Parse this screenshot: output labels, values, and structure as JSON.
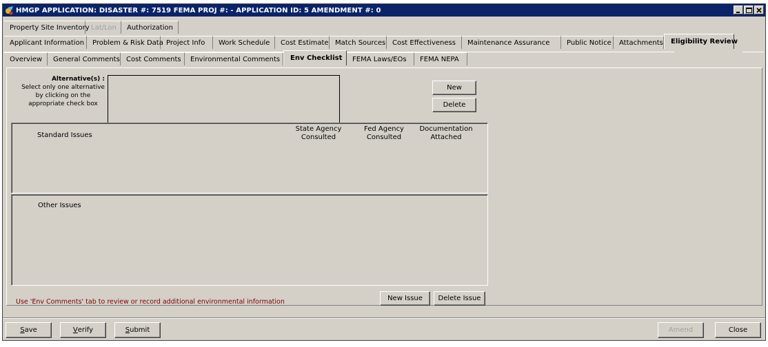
{
  "window": {
    "title": "HMGP APPLICATION:  DISASTER #: 7519   FEMA PROJ #:  -    APPLICATION ID: 5   AMENDMENT #: 0",
    "controls": [
      "minimize-icon",
      "maximize-icon",
      "close-icon"
    ]
  },
  "tabs_row1": [
    {
      "label": "Property Site Inventory",
      "enabled": true
    },
    {
      "label": "Lat/Lon",
      "enabled": false
    },
    {
      "label": "Authorization",
      "enabled": true
    }
  ],
  "tabs_row2": [
    {
      "label": "Applicant Information"
    },
    {
      "label": "Problem & Risk Data"
    },
    {
      "label": "Project Info"
    },
    {
      "label": "Work Schedule"
    },
    {
      "label": "Cost Estimate"
    },
    {
      "label": "Match Sources"
    },
    {
      "label": "Cost Effectiveness"
    },
    {
      "label": "Maintenance Assurance"
    },
    {
      "label": "Public Notice"
    },
    {
      "label": "Attachments"
    },
    {
      "label": "Eligibility Review",
      "active": true
    }
  ],
  "tabs_row3": [
    {
      "label": "Overview"
    },
    {
      "label": "General Comments"
    },
    {
      "label": "Cost Comments"
    },
    {
      "label": "Environmental Comments"
    },
    {
      "label": "Env Checklist",
      "active": true
    },
    {
      "label": "FEMA Laws/EOs"
    },
    {
      "label": "FEMA NEPA"
    }
  ],
  "alternatives": {
    "heading": "Alternative(s) :",
    "instructions": "Select only one alternative by clicking on the appropriate check box",
    "new_label": "New",
    "delete_label": "Delete"
  },
  "standard_issues": {
    "heading": "Standard Issues",
    "col_state": "State Agency Consulted",
    "col_fed": "Fed Agency Consulted",
    "col_doc": "Documentation Attached"
  },
  "other_issues": {
    "heading": "Other Issues"
  },
  "footer": {
    "message": "Use 'Env Comments' tab to review or record additional environmental information",
    "new_issue_label": "New Issue",
    "delete_issue_label": "Delete Issue"
  },
  "actions": {
    "save": {
      "label": "Save",
      "hotkey": "S"
    },
    "verify": {
      "label": "Verify",
      "hotkey": "V"
    },
    "submit": {
      "label": "Submit",
      "hotkey": "S"
    },
    "amend": {
      "label": "Amend",
      "enabled": false
    },
    "close": {
      "label": "Close"
    }
  },
  "colors": {
    "titlebar": "#0a246a",
    "face": "#d4d0c8",
    "footer_message": "#800000"
  }
}
